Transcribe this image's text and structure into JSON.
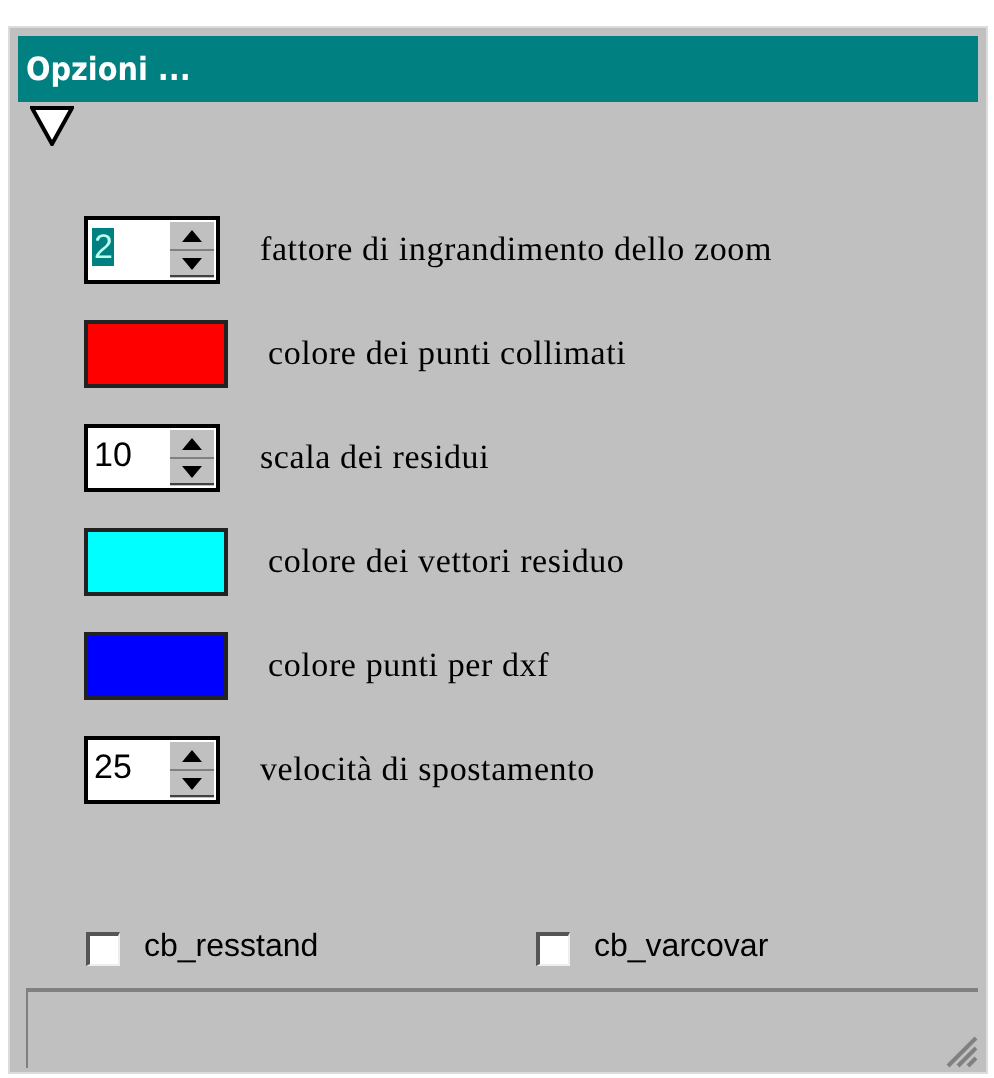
{
  "window": {
    "title": "Opzioni ..."
  },
  "options": [
    {
      "kind": "spinner",
      "value": "2",
      "highlighted": true,
      "label": "fattore di ingrandimento dello zoom"
    },
    {
      "kind": "color",
      "color": "#ff0000",
      "label": "colore dei punti collimati"
    },
    {
      "kind": "spinner",
      "value": "10",
      "highlighted": false,
      "label": "scala dei residui"
    },
    {
      "kind": "color",
      "color": "#00ffff",
      "label": "colore dei vettori residuo"
    },
    {
      "kind": "color",
      "color": "#0000ff",
      "label": "colore punti per dxf"
    },
    {
      "kind": "spinner",
      "value": "25",
      "highlighted": false,
      "label": "velocità di spostamento"
    }
  ],
  "checkboxes": [
    {
      "label": "cb_resstand",
      "checked": false
    },
    {
      "label": "cb_varcovar",
      "checked": false
    }
  ]
}
